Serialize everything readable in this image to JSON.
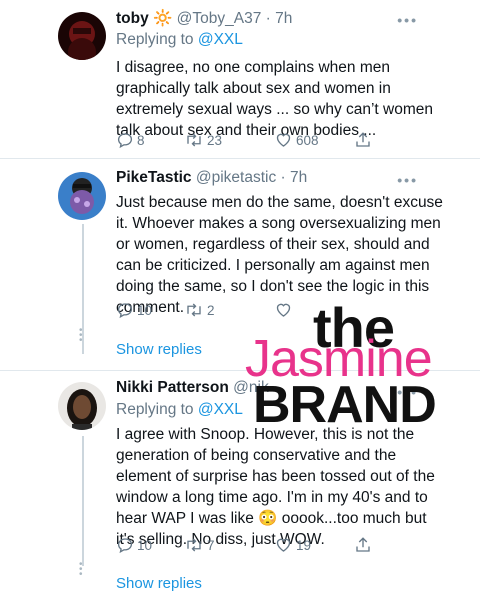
{
  "tweets": [
    {
      "name": "toby",
      "emoji": "🔆",
      "handle": "@Toby_A37",
      "time": "· 7h",
      "replying_prefix": "Replying to",
      "replying_to": "@XXL",
      "text": "I disagree, no one complains when men graphically talk about sex and women in extremely sexual ways ... so why can’t women talk about sex and their own bodies ...",
      "replies": "8",
      "retweets": "23",
      "likes": "608"
    },
    {
      "name": "PikeTastic",
      "handle": "@piketastic",
      "time": "· 7h",
      "text": "Just because men do the same, doesn't excuse it. Whoever makes a song oversexualizing men or women, regardless of their sex, should and can be criticized. I personally am against men doing the same, so I don't see the logic in this comment.",
      "replies": "10",
      "retweets": "2",
      "likes": "",
      "show_replies": "Show replies"
    },
    {
      "name": "Nikki Patterson",
      "handle": "@nik",
      "time": "",
      "replying_prefix": "Replying to",
      "replying_to": "@XXL",
      "text": "I agree with Snoop. However, this is not the generation of being conservative and the element of surprise has been tossed out of the window a long time ago. I'm in my 40's and to hear WAP I was like 😳 ooook...too much but it's selling. No diss, just WOW.",
      "replies": "10",
      "retweets": "7",
      "likes": "19",
      "show_replies": "Show replies"
    }
  ],
  "more_glyph": "•••",
  "watermark": {
    "the": "the",
    "jasmine": "Jasmine",
    "brand": "BRAND"
  },
  "colors": {
    "link": "#1b95e0",
    "muted": "#657786",
    "watermark_pink": "#e8338b"
  },
  "icons": [
    "reply-icon",
    "retweet-icon",
    "like-icon",
    "share-icon"
  ]
}
